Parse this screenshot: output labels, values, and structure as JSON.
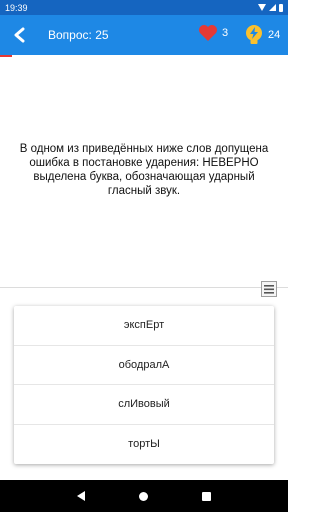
{
  "status_bar": {
    "time": "19:39"
  },
  "header": {
    "question_label": "Вопрос: 25",
    "lives_count": "3",
    "hints_count": "24"
  },
  "question": {
    "text": "В одном из приведённых ниже слов допущена ошибка в постановке ударения: НЕВЕРНО выделена буква, обозначающая ударный гласный звук."
  },
  "answers": [
    "экспЕрт",
    "ободралА",
    "слИвовый",
    "тортЫ"
  ],
  "colors": {
    "status_bar": "#1565c0",
    "app_bar": "#1e88e5",
    "heart": "#e53935",
    "bulb": "#fbc02d"
  },
  "icons": [
    "back-arrow-icon",
    "heart-icon",
    "lightbulb-icon",
    "menu-icon"
  ]
}
